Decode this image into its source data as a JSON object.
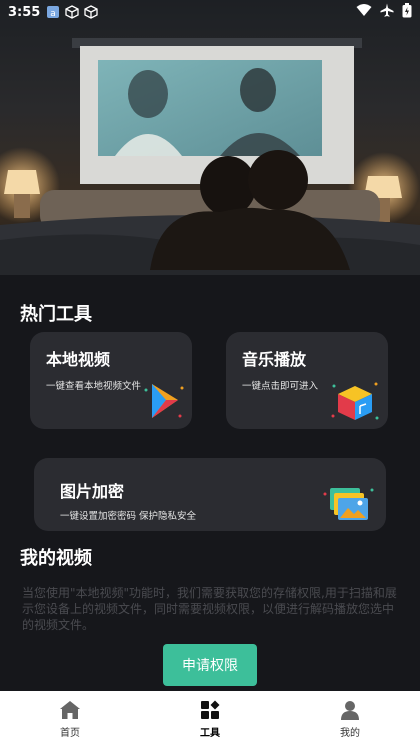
{
  "status_bar": {
    "time": "3:55",
    "icons_left": [
      "app-badge-icon",
      "cube-icon",
      "cube-icon"
    ],
    "icons_right": [
      "wifi-icon",
      "airplane-icon",
      "battery-icon"
    ]
  },
  "hot_tools": {
    "title": "热门工具",
    "cards": [
      {
        "title": "本地视频",
        "subtitle": "一键查看本地视频文件",
        "icon": "play-triangle-icon"
      },
      {
        "title": "音乐播放",
        "subtitle": "一键点击即可进入",
        "icon": "music-cube-icon"
      },
      {
        "title": "图片加密",
        "subtitle": "一键设置加密密码 保护隐私安全",
        "icon": "photo-stack-icon"
      }
    ]
  },
  "my_videos": {
    "title": "我的视频",
    "notice": "当您使用\"本地视频\"功能时，我们需要获取您的存储权限,用于扫描和展示您设备上的视频文件，同时需要视频权限，以便进行解码播放您选中的视频文件。",
    "apply_button": "申请权限"
  },
  "bottom_nav": [
    {
      "label": "首页",
      "icon": "home-icon",
      "active": false
    },
    {
      "label": "工具",
      "icon": "tools-grid-icon",
      "active": true
    },
    {
      "label": "我的",
      "icon": "user-icon",
      "active": false
    }
  ],
  "colors": {
    "background": "#16171b",
    "card": "#2b2c31",
    "accent": "#3dbf9a",
    "nav_background": "#ffffff"
  }
}
